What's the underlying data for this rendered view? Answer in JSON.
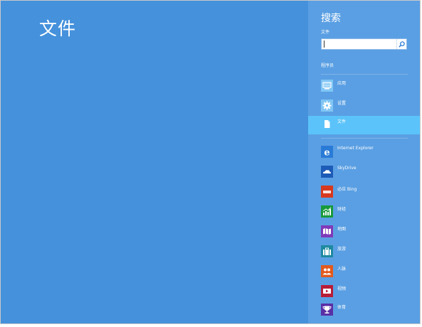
{
  "main": {
    "title": "文件"
  },
  "search_pane": {
    "title": "搜索",
    "scope_label": "文件",
    "search_value": "",
    "section_label": "程序员"
  },
  "categories": [
    {
      "label": "应用",
      "icon": "apps-icon",
      "color": "#7fc6f5",
      "selected": false
    },
    {
      "label": "设置",
      "icon": "gear-icon",
      "color": "#7fc6f5",
      "selected": false
    },
    {
      "label": "文件",
      "icon": "document-icon",
      "color": "#5bc3fa",
      "selected": true
    }
  ],
  "apps": [
    {
      "label": "Internet Explorer",
      "icon": "internet-explorer-icon",
      "color": "#2a7bd6"
    },
    {
      "label": "SkyDrive",
      "icon": "skydrive-cloud-icon",
      "color": "#1d5bb8"
    },
    {
      "label": "必应 Bing",
      "icon": "bing-icon",
      "color": "#d8391f"
    },
    {
      "label": "财经",
      "icon": "finance-chart-icon",
      "color": "#179a3b"
    },
    {
      "label": "地图",
      "icon": "map-icon",
      "color": "#7f3ab8"
    },
    {
      "label": "旅游",
      "icon": "travel-suitcase-icon",
      "color": "#1e8aa0"
    },
    {
      "label": "人脉",
      "icon": "people-icon",
      "color": "#e35a1e"
    },
    {
      "label": "视频",
      "icon": "video-icon",
      "color": "#b81d38"
    },
    {
      "label": "体育",
      "icon": "sports-trophy-icon",
      "color": "#5a2fa6"
    }
  ]
}
